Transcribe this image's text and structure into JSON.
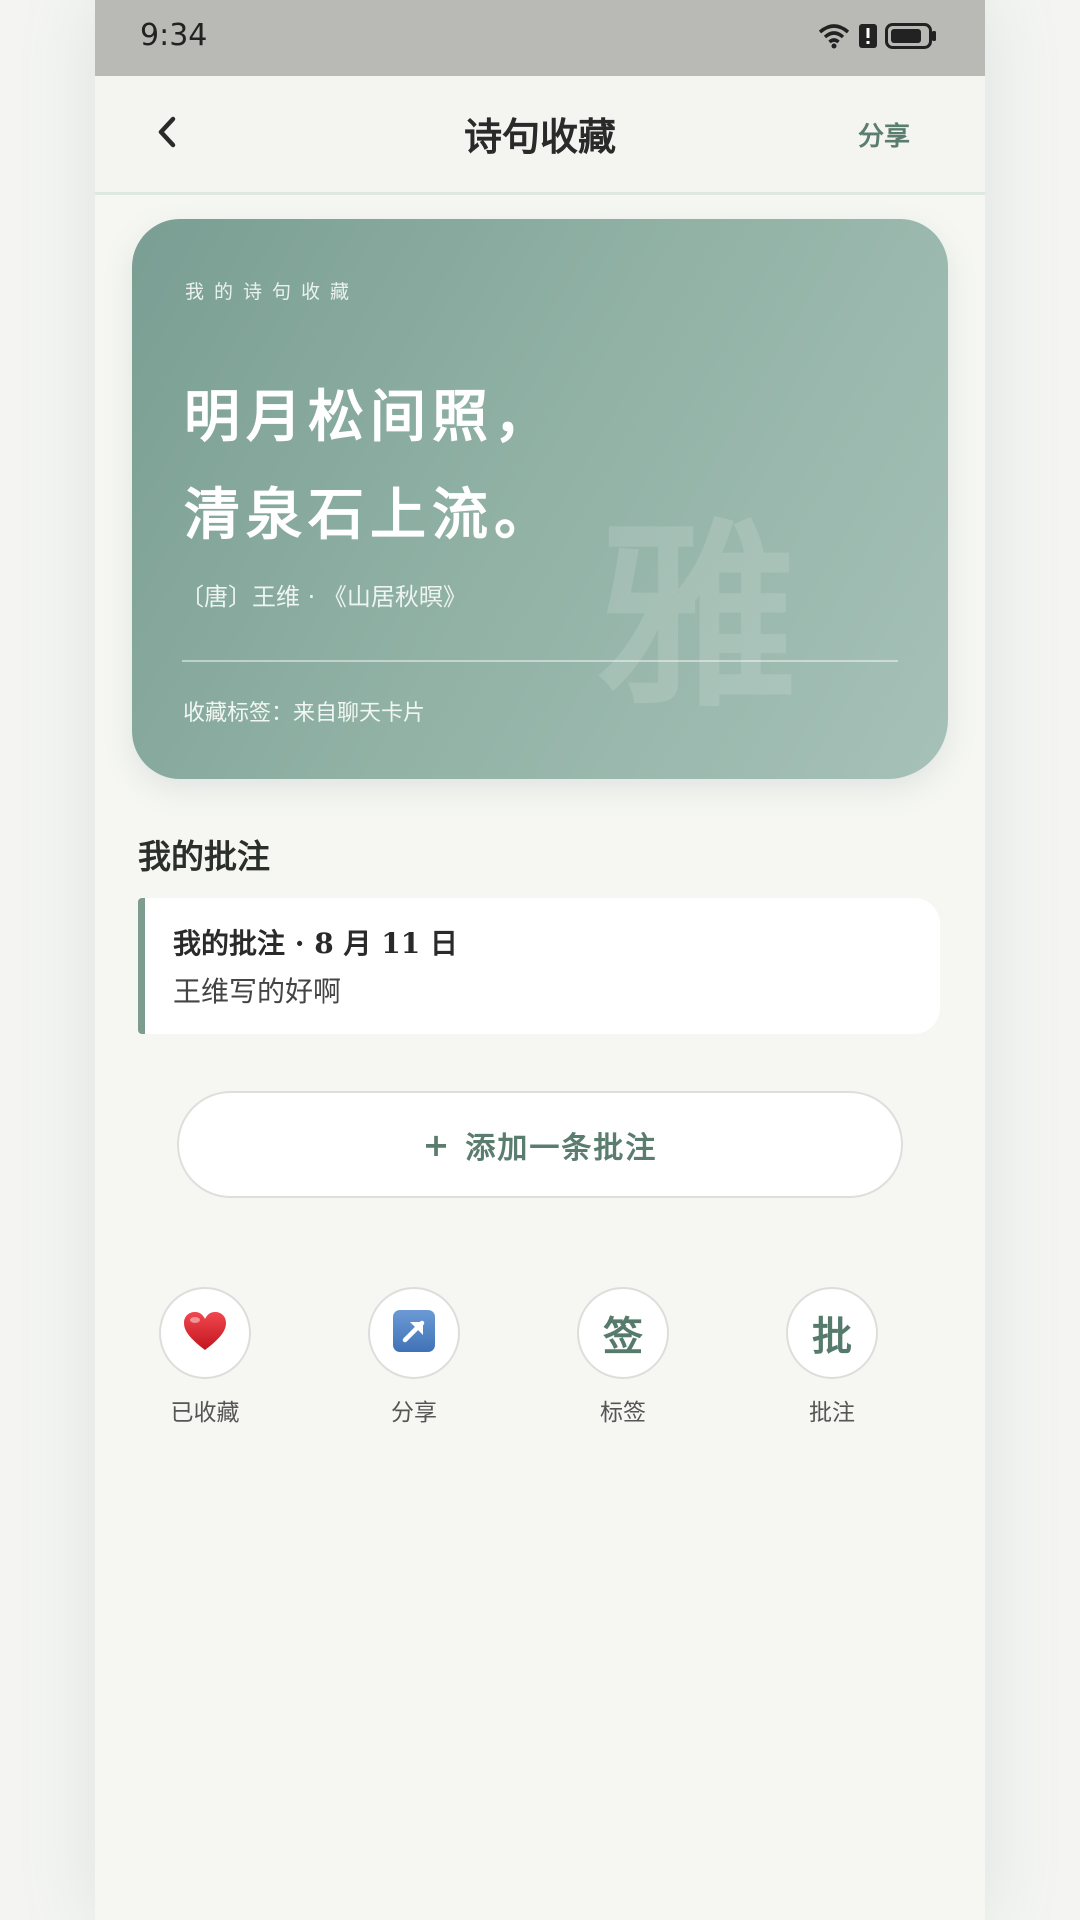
{
  "status_bar": {
    "time": "9:34"
  },
  "header": {
    "title": "诗句收藏",
    "share_label": "分享"
  },
  "poem_card": {
    "label": "我的诗句收藏",
    "lines": [
      "明月松间照，",
      "清泉石上流。"
    ],
    "author": "〔唐〕王维 · 《山居秋暝》",
    "tag": "收藏标签：来自聊天卡片",
    "watermark": "雅"
  },
  "notes": {
    "heading": "我的批注",
    "items": [
      {
        "title": "我的批注 · 8 月 11 日",
        "body": "王维写的好啊"
      }
    ]
  },
  "add_note": {
    "plus": "+",
    "label": "添加一条批注"
  },
  "actions": [
    {
      "icon": "heart-icon",
      "glyph": "",
      "label": "已收藏"
    },
    {
      "icon": "share-arrow-icon",
      "glyph": "",
      "label": "分享"
    },
    {
      "icon": "tag-icon",
      "glyph": "签",
      "label": "标签"
    },
    {
      "icon": "note-icon",
      "glyph": "批",
      "label": "批注"
    }
  ],
  "colors": {
    "accent": "#5b7d70",
    "card_start": "#7a9e93",
    "card_end": "#a6c1b8",
    "heart": "#d8222b",
    "share_icon": "#4f83c4"
  }
}
